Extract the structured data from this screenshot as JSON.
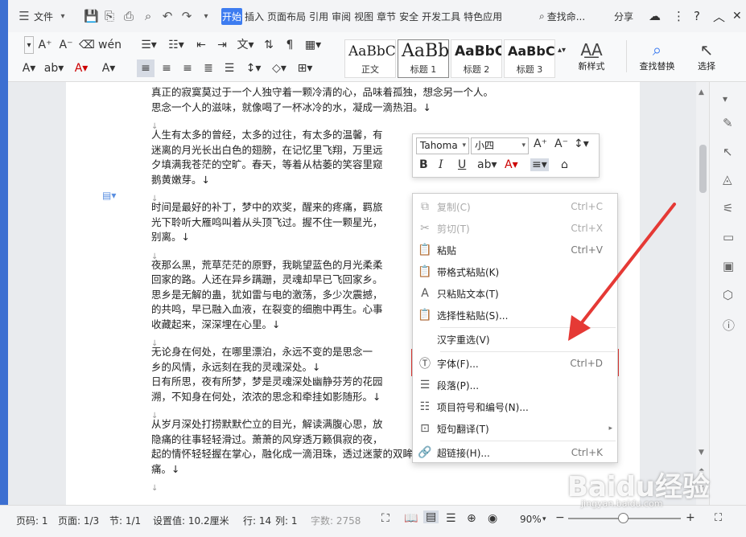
{
  "menu": {
    "file": "文件",
    "tabs": [
      "开始",
      "插入",
      "页面布局",
      "引用",
      "审阅",
      "视图",
      "章节",
      "安全",
      "开发工具",
      "特色应用"
    ],
    "active_tab": "开始",
    "search": "查找命...",
    "share": "分享"
  },
  "ribbon": {
    "styles": [
      {
        "preview": "AaBbCcDd",
        "label": "正文"
      },
      {
        "preview": "AaBb",
        "label": "标题 1"
      },
      {
        "preview": "AaBbC",
        "label": "标题 2"
      },
      {
        "preview": "AaBbC",
        "label": "标题 3"
      }
    ],
    "new_style": "新样式",
    "find_replace": "查找替换",
    "select": "选择"
  },
  "document": {
    "paragraphs": [
      [
        "真正的寂寞莫过于一个人独守着一颗冷清的心，品味着孤独，想念另一个人。",
        "思念一个人的滋味，就像喝了一杯冰冷的水，凝成一滴热泪。↓"
      ],
      [
        "↓"
      ],
      [
        "人生有太多的曾经，太多的过往，有太多的温馨，有",
        "迷离的月光长出白色的翅膀，在记忆里飞翔，万里远",
        "夕填满我苍茫的空旷。春天，等着从枯萎的笑容里窥",
        "鹅黄嫩芽。↓"
      ],
      [
        "↓"
      ],
      [
        "时间是最好的补丁，梦中的欢奖，醒来的疼痛，羁旅",
        "光下聆听大雁鸣叫着从头顶飞过。握不住一颗星光，",
        "别离。↓"
      ],
      [
        "↓"
      ],
      [
        "夜那么黑，荒草茫茫的原野，我眺望蓝色的月光柔柔",
        "回家的路。人还在异乡蹒跚，灵魂却早已飞回家乡。",
        "思乡是无解的蛊，犹如雷与电的激荡，多少次震撼，",
        "的共鸣，早已融入血液，在裂变的细胞中再生。心事",
        "收藏起来，深深埋在心里。↓"
      ],
      [
        "↓"
      ],
      [
        "无论身在何处，在哪里漂泊，永远不变的是思念一",
        "乡的风情，永远刻在我的灵魂深处。↓",
        "日有所思，夜有所梦，梦是灵魂深处幽静芬芳的花园",
        "溯，不知身在何处，浓浓的思念和牵挂如影随形。↓"
      ],
      [
        "↓"
      ],
      [
        "从岁月深处打捞默默伫立的目光，解读满腹心思，放",
        "隐痛的往事轻轻滑过。萧萧的风穿透万籁俱寂的夜，",
        "起的情怀轻轻握在掌心，融化成一滴泪珠，透过迷蒙的双眸渐渐化为潮湿的伤",
        "痛。↓"
      ],
      [
        "↓"
      ]
    ]
  },
  "mini_toolbar": {
    "font_name": "Tahoma",
    "font_size": "小四"
  },
  "context_menu": {
    "items": [
      {
        "icon": "copy-icon",
        "glyph": "⧉",
        "label": "复制(C)",
        "shortcut": "Ctrl+C",
        "disabled": true
      },
      {
        "icon": "cut-icon",
        "glyph": "✂",
        "label": "剪切(T)",
        "shortcut": "Ctrl+X",
        "disabled": true
      },
      {
        "icon": "paste-icon",
        "glyph": "📋",
        "label": "粘贴",
        "shortcut": "Ctrl+V",
        "disabled": false
      },
      {
        "icon": "paste-format-icon",
        "glyph": "📋",
        "label": "带格式粘贴(K)",
        "shortcut": "",
        "disabled": false
      },
      {
        "icon": "paste-text-icon",
        "glyph": "A",
        "label": "只粘贴文本(T)",
        "shortcut": "",
        "disabled": false
      },
      {
        "icon": "paste-special-icon",
        "glyph": "📋",
        "label": "选择性粘贴(S)...",
        "shortcut": "",
        "disabled": false
      },
      {
        "icon": "",
        "glyph": "",
        "label": "汉字重选(V)",
        "shortcut": "",
        "disabled": false
      },
      {
        "icon": "font-icon",
        "glyph": "Ⓣ",
        "label": "字体(F)...",
        "shortcut": "Ctrl+D",
        "disabled": false
      },
      {
        "icon": "paragraph-icon",
        "glyph": "☰",
        "label": "段落(P)...",
        "shortcut": "",
        "disabled": false
      },
      {
        "icon": "bullets-icon",
        "glyph": "☷",
        "label": "项目符号和编号(N)...",
        "shortcut": "",
        "disabled": false
      },
      {
        "icon": "translate-icon",
        "glyph": "⊡",
        "label": "短句翻译(T)",
        "shortcut": "",
        "disabled": false,
        "submenu": true
      },
      {
        "icon": "hyperlink-icon",
        "glyph": "🔗",
        "label": "超链接(H)...",
        "shortcut": "Ctrl+K",
        "disabled": false
      }
    ]
  },
  "status_bar": {
    "page_num": "页码: 1",
    "pages": "页面: 1/3",
    "section": "节: 1/1",
    "setting": "设置值: 10.2厘米",
    "row": "行: 14",
    "col": "列: 1",
    "words": "字数: 2758",
    "zoom": "90%"
  },
  "watermark": {
    "logo": "Baidu经验",
    "url": "jingyan.baidu.com"
  },
  "colors": {
    "accent": "#3d7cf0",
    "highlight_border": "#e53935",
    "arrow": "#e53935"
  }
}
